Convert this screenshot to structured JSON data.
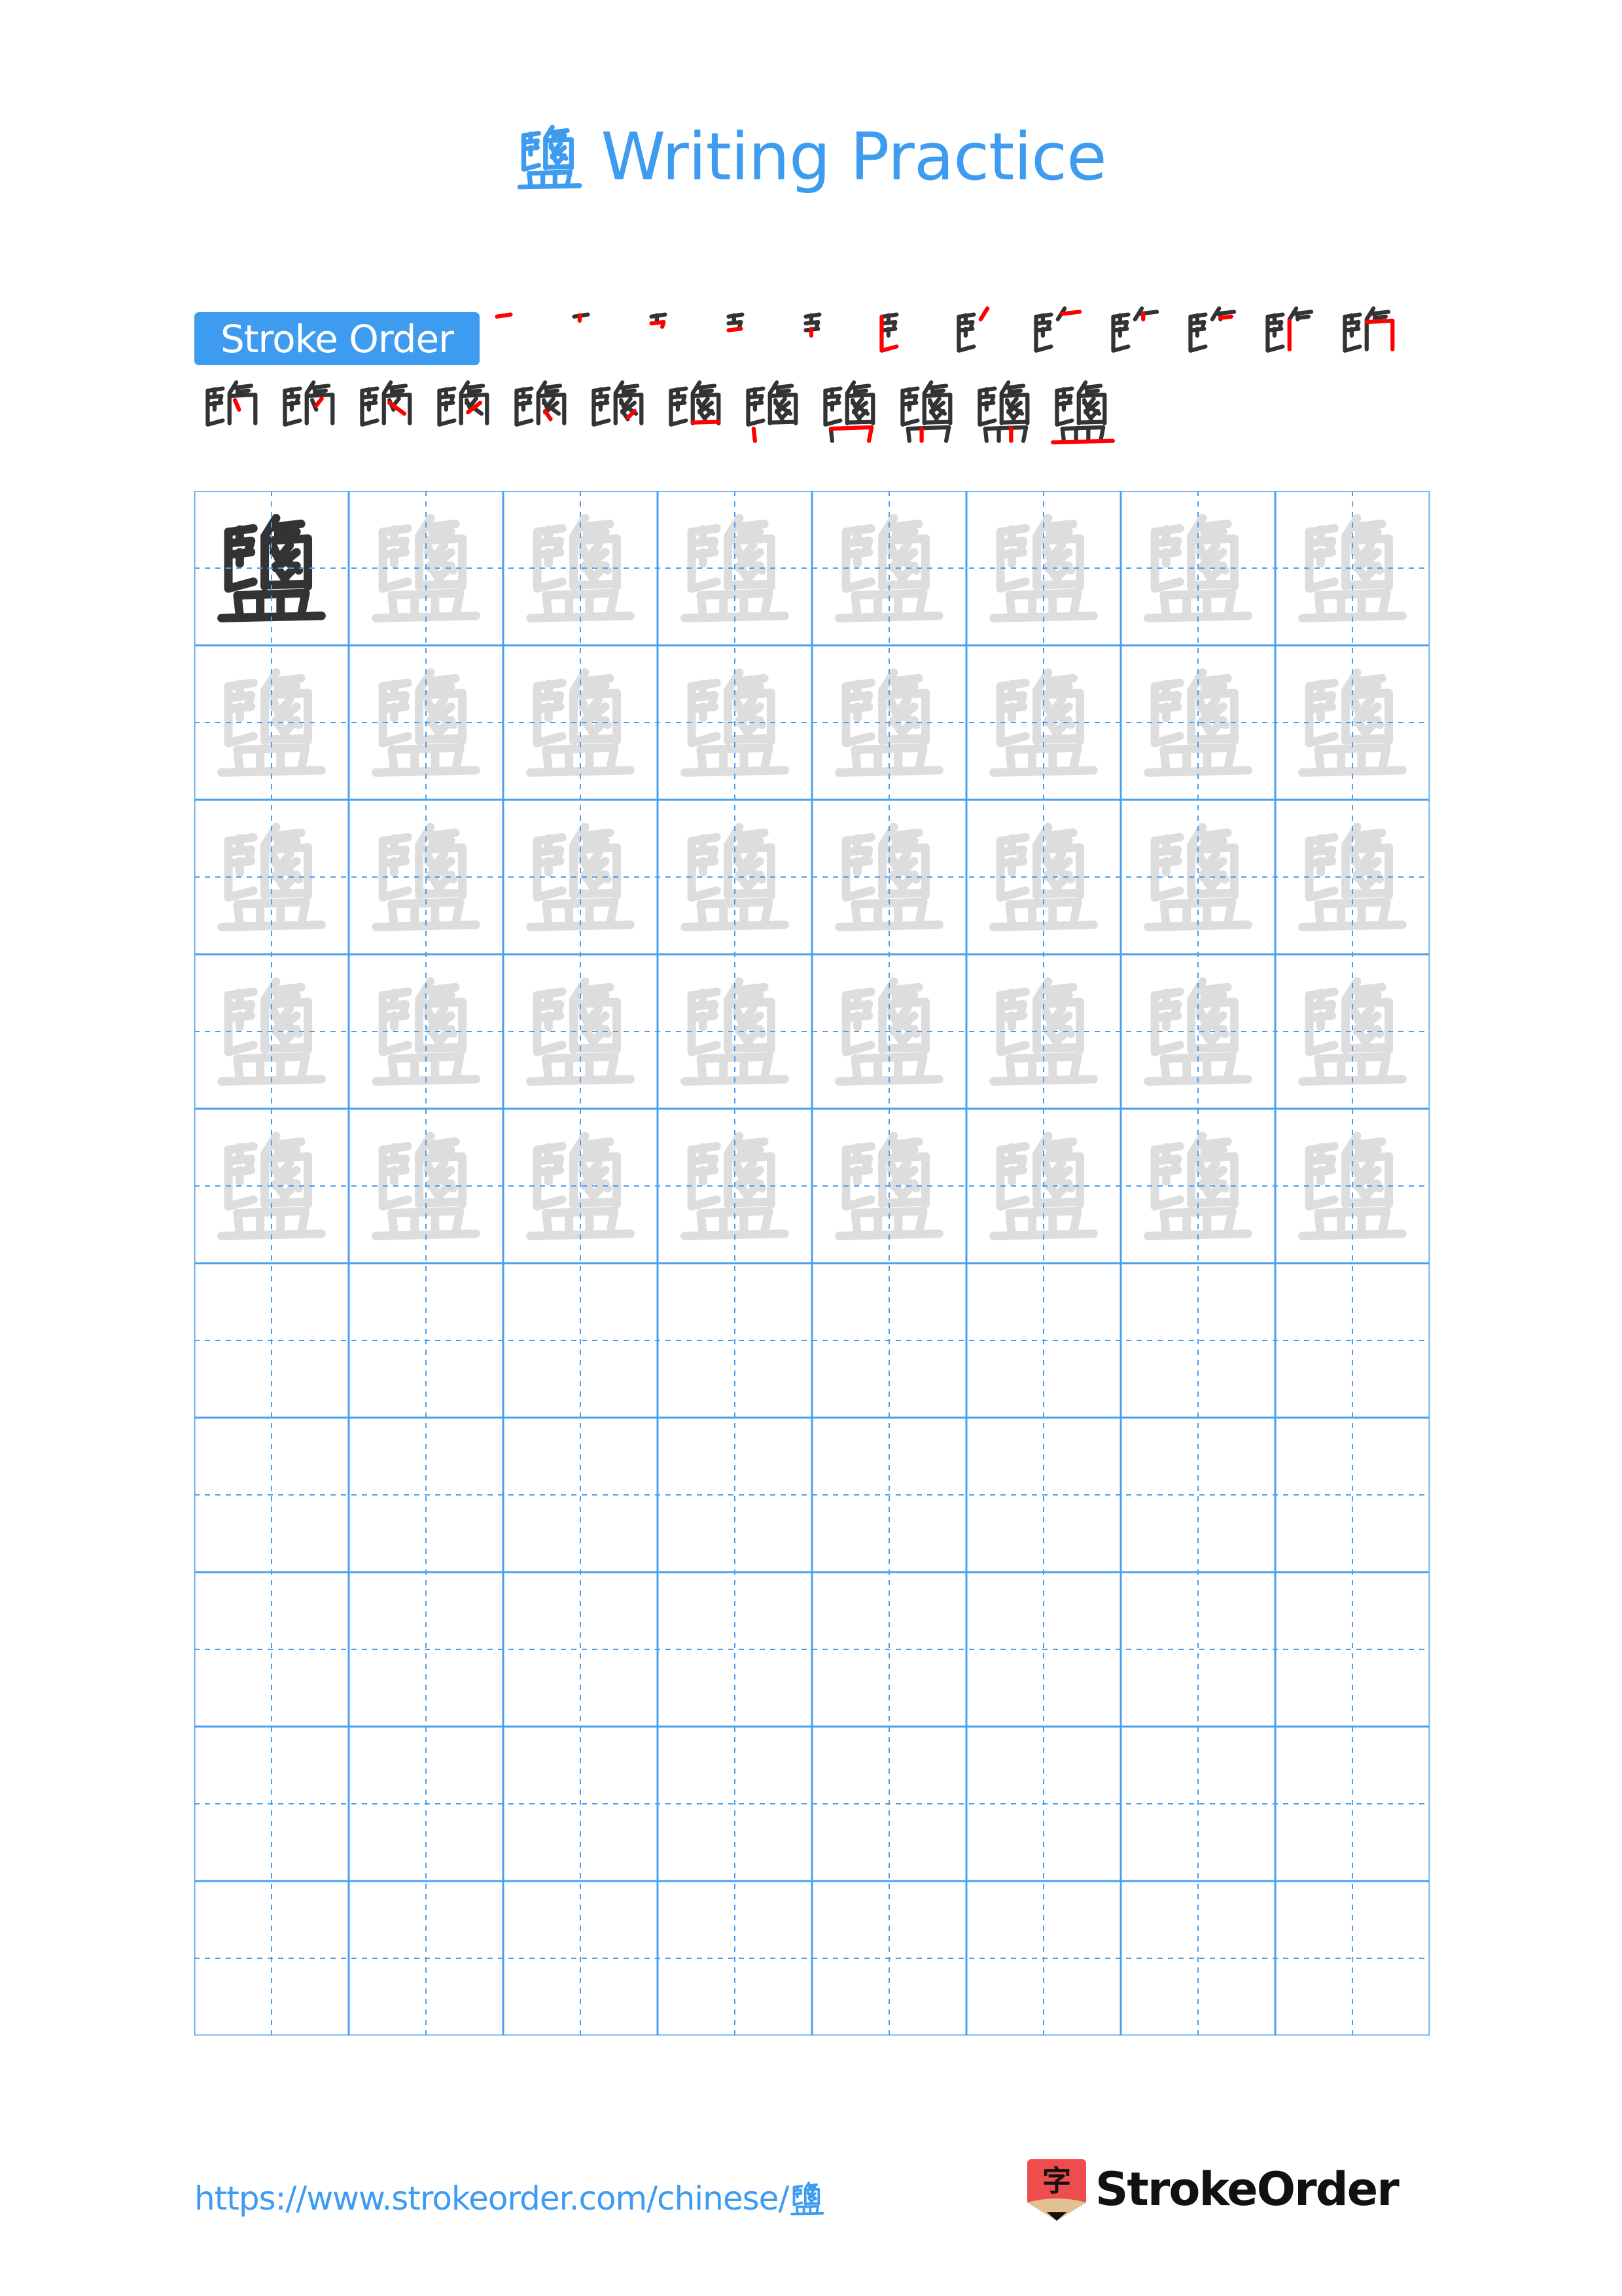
{
  "page": {
    "character": "鹽",
    "title_suffix": "Writing Practice",
    "title_full": "鹽 Writing Practice"
  },
  "stroke_order": {
    "label": "Stroke Order",
    "total_strokes": 24,
    "row1_steps": 12,
    "row2_steps": 12
  },
  "practice_grid": {
    "columns": 8,
    "rows": 10,
    "model_cells": 1,
    "trace_cells": 39,
    "blank_rows": 5,
    "guide_style": "dashed-cross"
  },
  "footer": {
    "url": "https://www.strokeorder.com/chinese/",
    "url_character": "鹽",
    "logo_icon_char": "字",
    "logo_text": "StrokeOrder"
  },
  "colors": {
    "accent": "#3d9bf0",
    "grid_line": "#4aa0f0",
    "model_glyph": "#333333",
    "trace_glyph": "#dddddd",
    "current_stroke": "#ff0000",
    "logo_red": "#ef4d4d",
    "logo_tan": "#e3bf94",
    "logo_text": "#111111"
  }
}
